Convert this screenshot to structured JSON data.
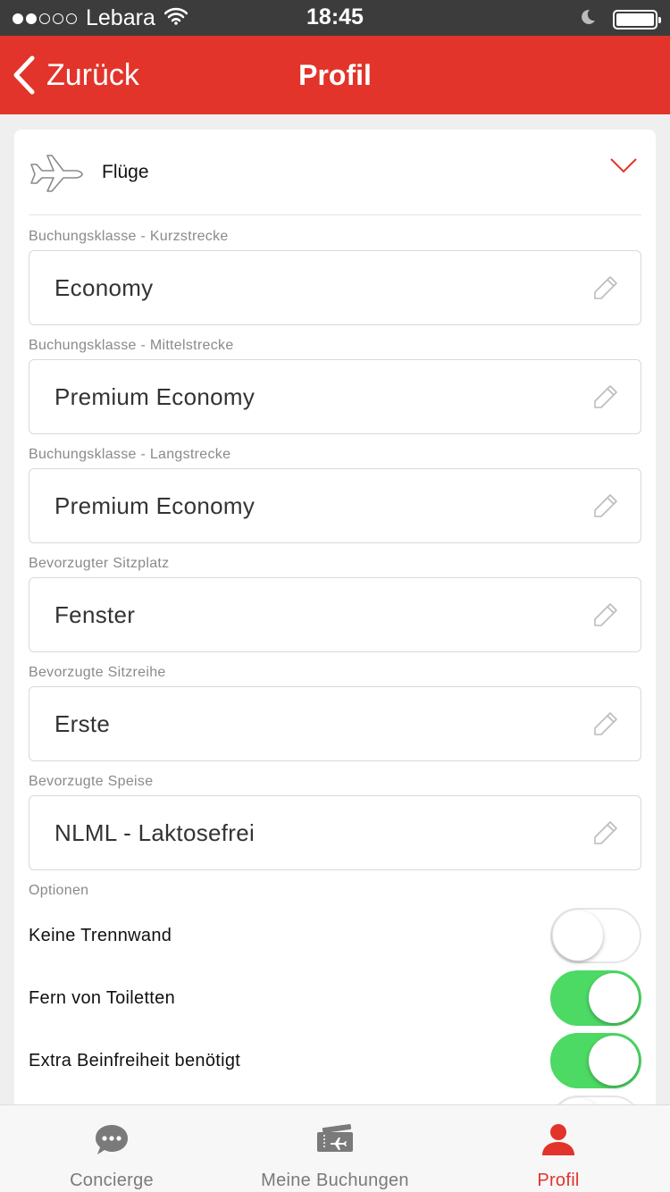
{
  "status_bar": {
    "carrier": "Lebara",
    "time": "18:45",
    "signal_bars_filled": 2,
    "signal_bars_total": 5
  },
  "nav": {
    "back_label": "Zurück",
    "title": "Profil"
  },
  "section": {
    "title": "Flüge",
    "expanded": true
  },
  "fields": [
    {
      "label": "Buchungsklasse - Kurzstrecke",
      "value": "Economy"
    },
    {
      "label": "Buchungsklasse - Mittelstrecke",
      "value": "Premium Economy"
    },
    {
      "label": "Buchungsklasse - Langstrecke",
      "value": "Premium Economy"
    },
    {
      "label": "Bevorzugter Sitzplatz",
      "value": "Fenster"
    },
    {
      "label": "Bevorzugte Sitzreihe",
      "value": "Erste"
    },
    {
      "label": "Bevorzugte Speise",
      "value": "NLML - Laktosefrei"
    }
  ],
  "options": {
    "label": "Optionen",
    "items": [
      {
        "label": "Keine Trennwand",
        "enabled": false
      },
      {
        "label": "Fern von Toiletten",
        "enabled": true
      },
      {
        "label": "Extra Beinfreiheit benötigt",
        "enabled": true
      }
    ]
  },
  "tabs": [
    {
      "label": "Concierge",
      "icon": "chat-bubble-icon",
      "active": false
    },
    {
      "label": "Meine Buchungen",
      "icon": "ticket-icon",
      "active": false
    },
    {
      "label": "Profil",
      "icon": "person-icon",
      "active": true
    }
  ],
  "colors": {
    "brand": "#e2342a",
    "toggle_on": "#4cd964",
    "status_bar": "#3c3c3c"
  }
}
